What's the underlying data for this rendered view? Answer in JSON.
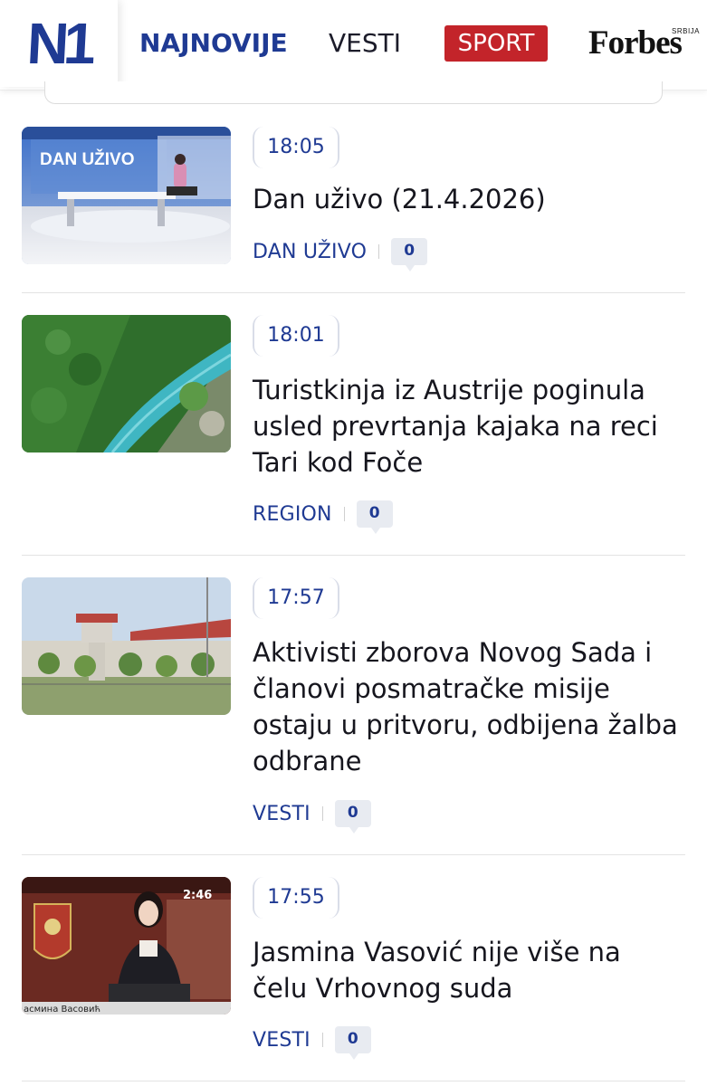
{
  "header": {
    "logo": "N1",
    "nav": {
      "najnovije": "NAJNOVIJE",
      "vesti": "VESTI",
      "sport": "SPORT"
    },
    "partner": {
      "name": "Forbes",
      "sub": "SRBIJA"
    }
  },
  "colors": {
    "brand_blue": "#1f3a93",
    "sport_red": "#c3242a",
    "text": "#16161e",
    "badge_bg": "#e8ebf1"
  },
  "articles": [
    {
      "time": "18:05",
      "title": "Dan uživo (21.4.2026)",
      "category": "DAN UŽIVO",
      "comments": "0",
      "thumb_caption": "DAN UŽIVO"
    },
    {
      "time": "18:01",
      "title": "Turistkinja iz Austrije poginula usled prevrtanja kajaka na reci Tari kod Foče",
      "category": "REGION",
      "comments": "0"
    },
    {
      "time": "17:57",
      "title": "Aktivisti zborova Novog Sada i članovi posmatračke misije ostaju u pritvoru, odbijena žalba odbrane",
      "category": "VESTI",
      "comments": "0"
    },
    {
      "time": "17:55",
      "title": "Jasmina Vasović nije više na čelu Vrhovnog suda",
      "category": "VESTI",
      "comments": "0",
      "thumb_caption": "асмина Васовић",
      "thumb_clock": "2:46"
    }
  ]
}
